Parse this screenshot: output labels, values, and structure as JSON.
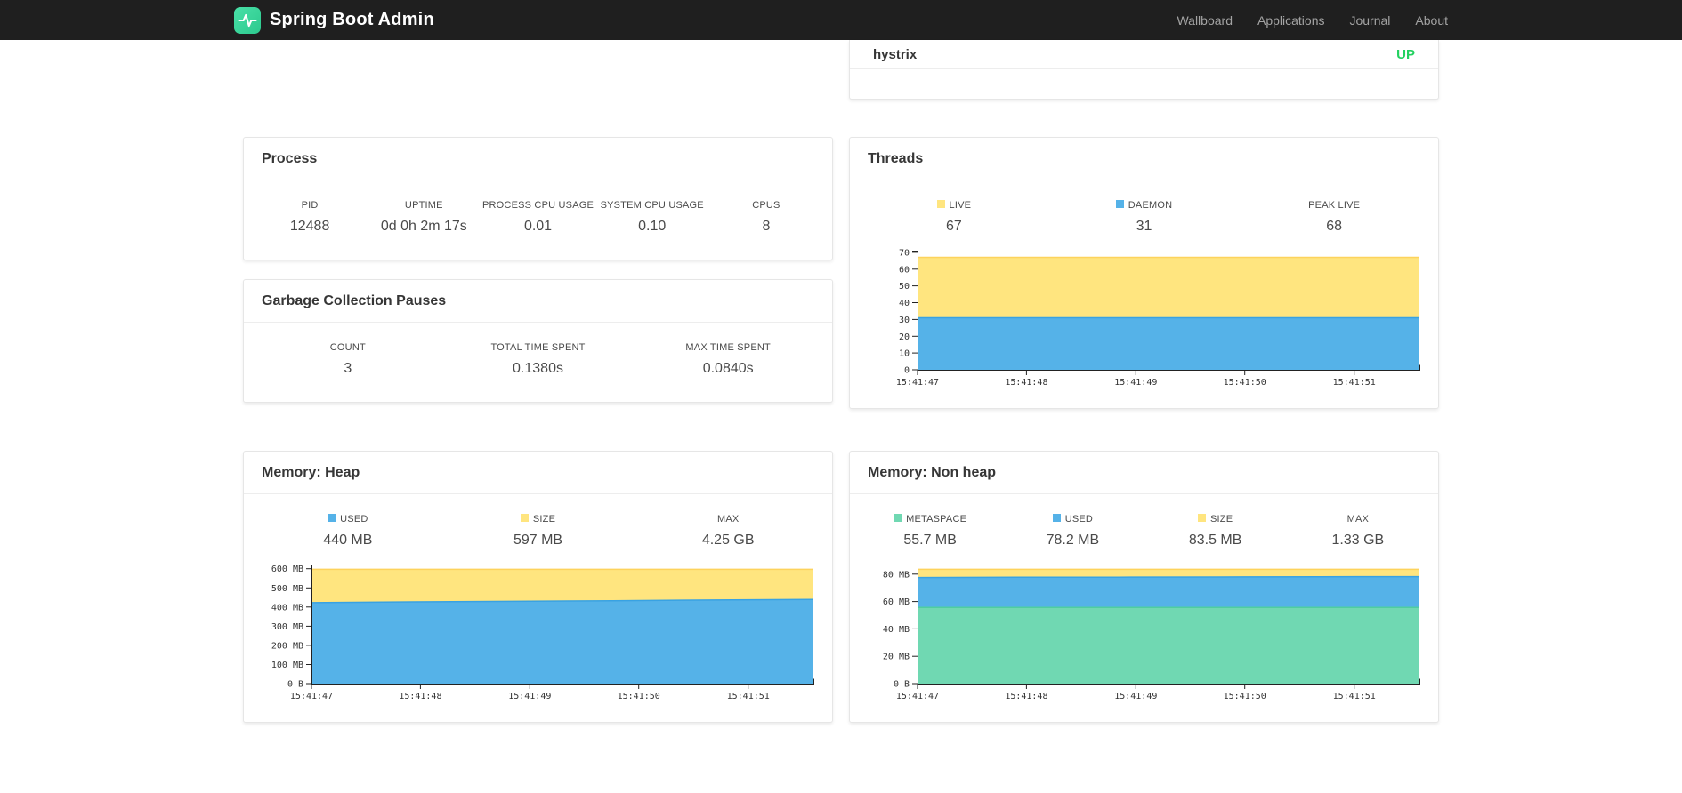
{
  "navbar": {
    "brand": "Spring Boot Admin",
    "links": [
      "Wallboard",
      "Applications",
      "Journal",
      "About"
    ]
  },
  "colors": {
    "status_up": "#23d160",
    "brand_teal": "#3ad79c",
    "chart_yellow": "#ffe57f",
    "chart_blue": "#55b2e8",
    "chart_green": "#70d8b2"
  },
  "instances_panel": {
    "rows": [
      {
        "name": "hystrix",
        "status": "UP"
      }
    ]
  },
  "panels": {
    "process": {
      "title": "Process",
      "stats": [
        {
          "label": "PID",
          "value": "12488"
        },
        {
          "label": "UPTIME",
          "value": "0d 0h 2m 17s"
        },
        {
          "label": "PROCESS CPU USAGE",
          "value": "0.01"
        },
        {
          "label": "SYSTEM CPU USAGE",
          "value": "0.10"
        },
        {
          "label": "CPUS",
          "value": "8"
        }
      ]
    },
    "gc": {
      "title": "Garbage Collection Pauses",
      "stats": [
        {
          "label": "COUNT",
          "value": "3"
        },
        {
          "label": "TOTAL TIME SPENT",
          "value": "0.1380s"
        },
        {
          "label": "MAX TIME SPENT",
          "value": "0.0840s"
        }
      ]
    },
    "threads": {
      "title": "Threads",
      "stats": [
        {
          "label": "LIVE",
          "value": "67",
          "swatch": "#ffe57f"
        },
        {
          "label": "DAEMON",
          "value": "31",
          "swatch": "#55b2e8"
        },
        {
          "label": "PEAK LIVE",
          "value": "68"
        }
      ]
    },
    "heap": {
      "title": "Memory: Heap",
      "stats": [
        {
          "label": "USED",
          "value": "440 MB",
          "swatch": "#55b2e8"
        },
        {
          "label": "SIZE",
          "value": "597 MB",
          "swatch": "#ffe57f"
        },
        {
          "label": "MAX",
          "value": "4.25 GB"
        }
      ]
    },
    "nonheap": {
      "title": "Memory: Non heap",
      "stats": [
        {
          "label": "METASPACE",
          "value": "55.7 MB",
          "swatch": "#70d8b2"
        },
        {
          "label": "USED",
          "value": "78.2 MB",
          "swatch": "#55b2e8"
        },
        {
          "label": "SIZE",
          "value": "83.5 MB",
          "swatch": "#ffe57f"
        },
        {
          "label": "MAX",
          "value": "1.33 GB"
        }
      ]
    }
  },
  "chart_data": [
    {
      "type": "area",
      "title": "Threads",
      "legend_position": "top",
      "grid": false,
      "x_ticks": [
        "15:41:47",
        "15:41:48",
        "15:41:49",
        "15:41:50",
        "15:41:51"
      ],
      "x_tick_fracs": [
        0,
        0.217,
        0.435,
        0.652,
        0.87
      ],
      "y_domain": [
        0,
        71
      ],
      "y_ticks": [
        {
          "v": 0,
          "label": "0"
        },
        {
          "v": 10,
          "label": "10"
        },
        {
          "v": 20,
          "label": "20"
        },
        {
          "v": 30,
          "label": "30"
        },
        {
          "v": 40,
          "label": "40"
        },
        {
          "v": 50,
          "label": "50"
        },
        {
          "v": 60,
          "label": "60"
        },
        {
          "v": 70,
          "label": "70"
        }
      ],
      "series": [
        {
          "name": "live",
          "fill": "#ffe57f",
          "stroke": "#fdd35c",
          "values": [
            67,
            67,
            67,
            67,
            67,
            67
          ]
        },
        {
          "name": "daemon",
          "fill": "#55b2e8",
          "stroke": "#39a2e2",
          "values": [
            31,
            31,
            31,
            31,
            31,
            31
          ]
        }
      ]
    },
    {
      "type": "area",
      "title": "Memory: Heap",
      "legend_position": "top",
      "grid": false,
      "x_ticks": [
        "15:41:47",
        "15:41:48",
        "15:41:49",
        "15:41:50",
        "15:41:51"
      ],
      "x_tick_fracs": [
        0,
        0.217,
        0.435,
        0.652,
        0.87
      ],
      "y_domain": [
        0,
        622
      ],
      "y_ticks": [
        {
          "v": 0,
          "label": "0 B"
        },
        {
          "v": 100,
          "label": "100 MB"
        },
        {
          "v": 200,
          "label": "200 MB"
        },
        {
          "v": 300,
          "label": "300 MB"
        },
        {
          "v": 400,
          "label": "400 MB"
        },
        {
          "v": 500,
          "label": "500 MB"
        },
        {
          "v": 600,
          "label": "600 MB"
        }
      ],
      "series": [
        {
          "name": "size",
          "fill": "#ffe57f",
          "stroke": "#fdd35c",
          "values": [
            597,
            597,
            597,
            597,
            597,
            597
          ]
        },
        {
          "name": "used",
          "fill": "#55b2e8",
          "stroke": "#39a2e2",
          "values": [
            423,
            427,
            430,
            433,
            437,
            440
          ]
        }
      ]
    },
    {
      "type": "area",
      "title": "Memory: Non heap",
      "legend_position": "top",
      "grid": false,
      "x_ticks": [
        "15:41:47",
        "15:41:48",
        "15:41:49",
        "15:41:50",
        "15:41:51"
      ],
      "x_tick_fracs": [
        0,
        0.217,
        0.435,
        0.652,
        0.87
      ],
      "y_domain": [
        0,
        87
      ],
      "y_ticks": [
        {
          "v": 0,
          "label": "0 B"
        },
        {
          "v": 20,
          "label": "20 MB"
        },
        {
          "v": 40,
          "label": "40 MB"
        },
        {
          "v": 60,
          "label": "60 MB"
        },
        {
          "v": 80,
          "label": "80 MB"
        }
      ],
      "series": [
        {
          "name": "size",
          "fill": "#ffe57f",
          "stroke": "#fdd35c",
          "values": [
            83.5,
            83.5,
            83.5,
            83.5,
            83.5,
            83.5
          ]
        },
        {
          "name": "used",
          "fill": "#55b2e8",
          "stroke": "#39a2e2",
          "values": [
            77.5,
            77.7,
            77.8,
            77.9,
            78.1,
            78.2
          ]
        },
        {
          "name": "metaspace",
          "fill": "#70d8b2",
          "stroke": "#4fcda0",
          "values": [
            55.7,
            55.7,
            55.7,
            55.7,
            55.7,
            55.7
          ]
        }
      ]
    }
  ]
}
